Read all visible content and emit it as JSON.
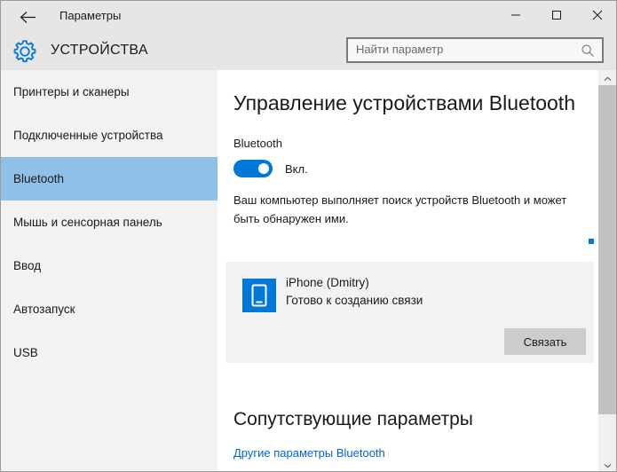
{
  "window": {
    "title": "Параметры",
    "back_icon": "back-arrow-icon",
    "minimize_icon": "minimize-icon",
    "maximize_icon": "maximize-icon",
    "close_icon": "close-icon"
  },
  "header": {
    "category": "УСТРОЙСТВА",
    "gear_icon": "gear-icon",
    "accent_color": "#0078d7"
  },
  "search": {
    "value": "",
    "placeholder": "Найти параметр",
    "icon": "search-icon"
  },
  "sidebar": {
    "selected_index": 2,
    "highlight_color": "#8fc1e8",
    "items": [
      {
        "label": "Принтеры и сканеры"
      },
      {
        "label": "Подключенные устройства"
      },
      {
        "label": "Bluetooth"
      },
      {
        "label": "Мышь и сенсорная панель"
      },
      {
        "label": "Ввод"
      },
      {
        "label": "Автозапуск"
      },
      {
        "label": "USB"
      }
    ]
  },
  "main": {
    "page_title": "Управление устройствами Bluetooth",
    "bluetooth": {
      "label": "Bluetooth",
      "toggle_state": "on",
      "toggle_label": "Вкл.",
      "toggle_color": "#0078d7"
    },
    "description": "Ваш компьютер выполняет поиск устройств Bluetooth и может быть обнаружен ими.",
    "scanning_indicator": "scanning-dot",
    "device": {
      "icon": "phone-icon",
      "name": "iPhone (Dmitry)",
      "status": "Готово к созданию связи",
      "action_label": "Связать"
    },
    "related": {
      "title": "Сопутствующие параметры",
      "link_label": "Другие параметры Bluetooth",
      "link_color": "#0066cc"
    }
  },
  "scrollbar": {
    "up_icon": "chevron-up-icon",
    "down_icon": "chevron-down-icon"
  }
}
